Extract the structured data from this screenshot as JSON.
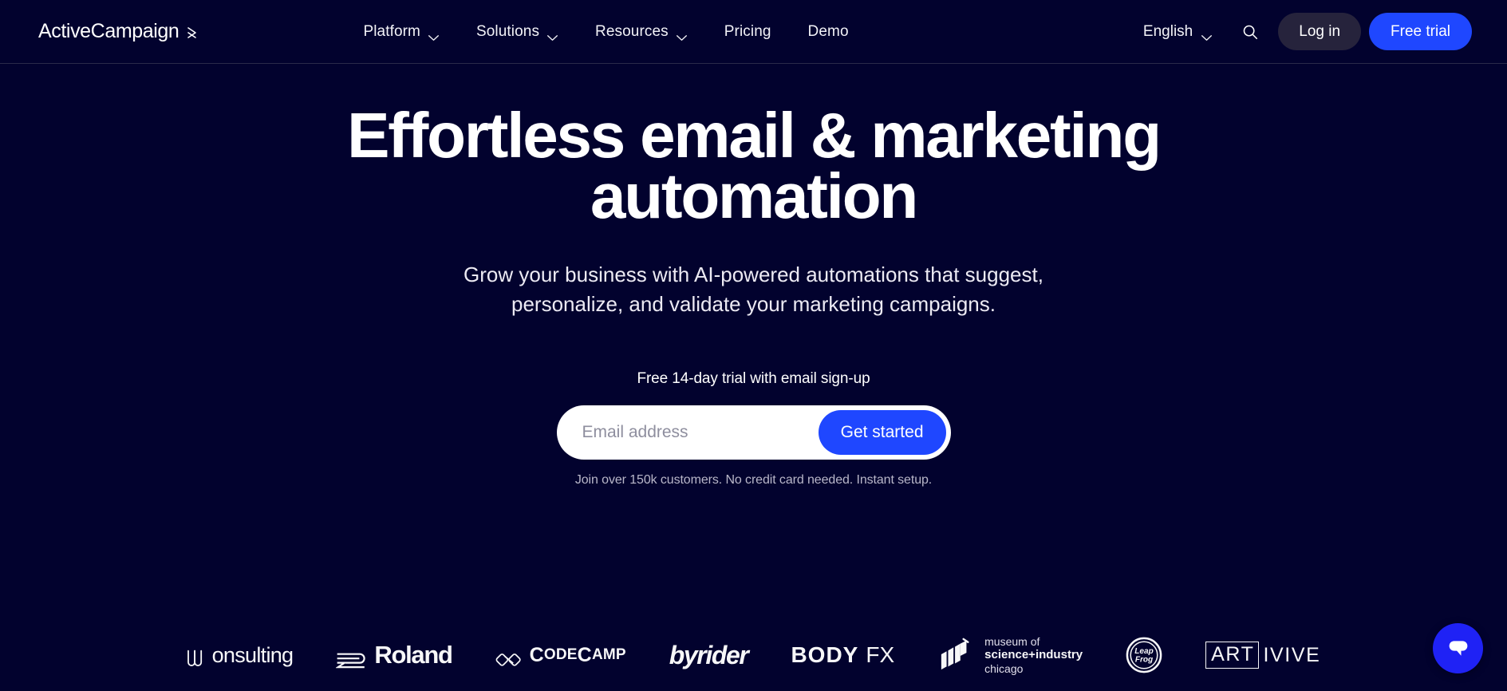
{
  "header": {
    "brand": {
      "name": "ActiveCampaign",
      "mark_icon": "chevron-right-double-icon"
    },
    "nav": [
      {
        "label": "Platform",
        "has_dropdown": true,
        "icon": "chevron-down-icon"
      },
      {
        "label": "Solutions",
        "has_dropdown": true,
        "icon": "chevron-down-icon"
      },
      {
        "label": "Resources",
        "has_dropdown": true,
        "icon": "chevron-down-icon"
      },
      {
        "label": "Pricing",
        "has_dropdown": false
      },
      {
        "label": "Demo",
        "has_dropdown": false
      }
    ],
    "language": {
      "label": "English",
      "icon": "chevron-down-icon"
    },
    "search_icon": "search-icon",
    "login_label": "Log in",
    "trial_label": "Free trial"
  },
  "hero": {
    "title": "Effortless email & marketing automation",
    "subtitle": "Grow your business with AI-powered automations that suggest, personalize, and validate your marketing campaigns.",
    "trial_note": "Free 14-day trial with email sign-up",
    "email_placeholder": "Email address",
    "email_value": "",
    "cta_label": "Get started",
    "fineprint": "Join over 150k customers. No credit card needed. Instant setup."
  },
  "logos": [
    {
      "name": "Wonsulting",
      "text": "onsulting",
      "mark": "wonsulting-w-monogram"
    },
    {
      "name": "Roland",
      "text": "Roland",
      "mark": "roland-mark"
    },
    {
      "name": "CodeCamp",
      "text_a": "C",
      "text_b": "ODE",
      "text_c": "C",
      "text_d": "AMP",
      "mark": "codecamp-mark"
    },
    {
      "name": "byrider",
      "text": "byrider"
    },
    {
      "name": "BODY FX",
      "text_a": "BODY",
      "text_b": "FX"
    },
    {
      "name": "Museum of Science+Industry Chicago",
      "line1": "museum of",
      "line2": "science+industry",
      "line3": "chicago",
      "mark": "msi-mark"
    },
    {
      "name": "LeapFrog",
      "text_a": "Leap",
      "text_b": "Frog",
      "mark": "leapfrog-mark"
    },
    {
      "name": "Artivive",
      "text_a": "ART",
      "text_b": "IVIVE"
    }
  ],
  "chat": {
    "label": "Open chat",
    "icon": "chat-bubble-icon"
  },
  "colors": {
    "background": "#02022e",
    "accent_blue": "#1f47ff",
    "login_pill": "#26233c",
    "chat_blue": "#1f22f5",
    "text_primary": "#ffffff",
    "text_muted": "#b9b7c9"
  }
}
